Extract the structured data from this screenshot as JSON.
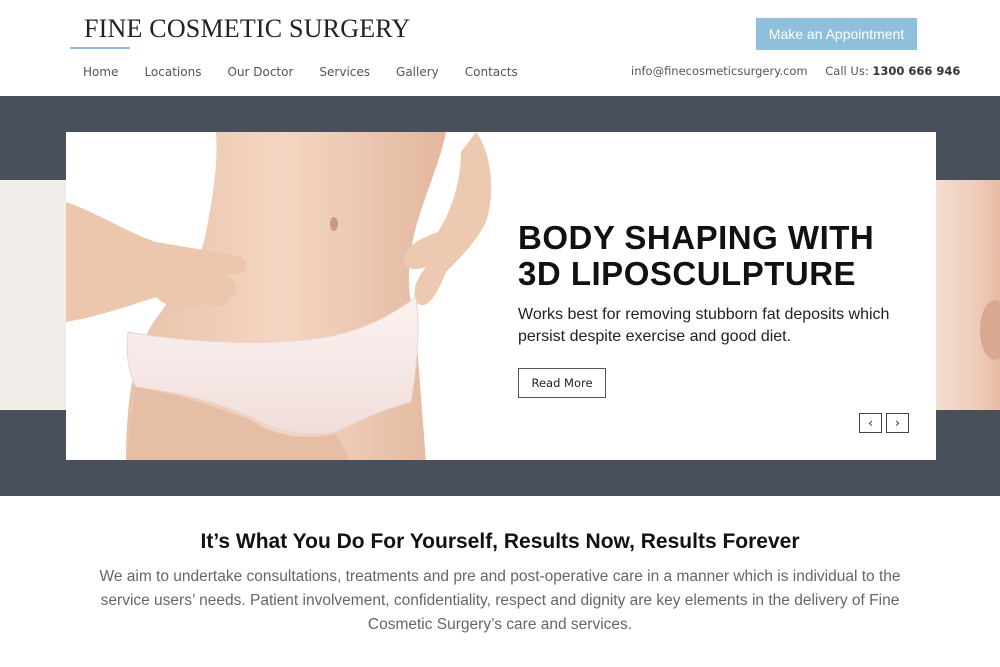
{
  "header": {
    "logo": "FINE COSMETIC SURGERY",
    "nav": [
      "Home",
      "Locations",
      "Our Doctor",
      "Services",
      "Gallery",
      "Contacts"
    ],
    "appointment_label": "Make an Appointment",
    "email": "info@finecosmeticsurgery.com",
    "call_label": "Call Us:",
    "phone": "1300 666 946"
  },
  "hero": {
    "title": "BODY SHAPING WITH 3D LIPOSCULPTURE",
    "description": "Works best for removing stubborn fat deposits which persist despite exercise and good diet.",
    "read_more_label": "Read More",
    "prev_label": "‹",
    "next_label": "›",
    "image_subject": "woman-torso-in-underwear"
  },
  "intro": {
    "heading": "It’s What You Do For Yourself, Results Now, Results Forever",
    "text": "We aim to undertake consultations, treatments and pre and post-operative care in a manner which is individual to the service users’ needs. Patient involvement, confidentiality, respect and dignity are key elements in the delivery of Fine Cosmetic Surgery’s care and services."
  },
  "colors": {
    "accent": "#8ec0dc",
    "hero_frame": "#4a4f5c",
    "text_muted": "#666666"
  }
}
